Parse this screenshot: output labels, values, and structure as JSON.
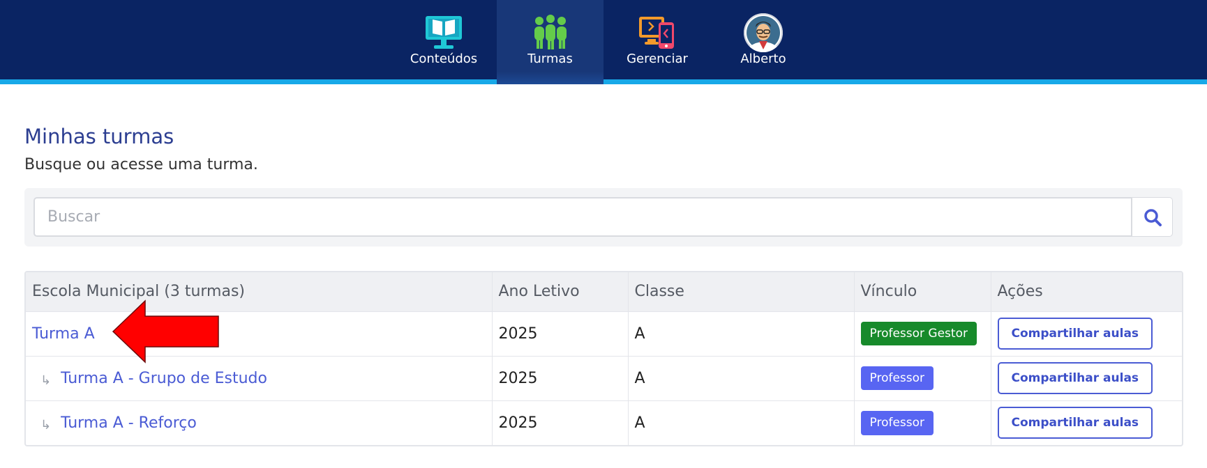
{
  "nav": {
    "items": [
      {
        "label": "Conteúdos",
        "icon": "monitor-book-icon"
      },
      {
        "label": "Turmas",
        "icon": "people-group-icon",
        "active": true
      },
      {
        "label": "Gerenciar",
        "icon": "devices-manage-icon"
      },
      {
        "label": "Alberto",
        "icon": "user-avatar"
      }
    ]
  },
  "page": {
    "title": "Minhas turmas",
    "subtitle": "Busque ou acesse uma turma."
  },
  "search": {
    "placeholder": "Buscar",
    "value": ""
  },
  "table": {
    "headers": [
      "Escola Municipal (3 turmas)",
      "Ano Letivo",
      "Classe",
      "Vínculo",
      "Ações"
    ],
    "rows": [
      {
        "name": "Turma A",
        "year": "2025",
        "classe": "A",
        "vinculo": "Professor Gestor",
        "action": "Compartilhar aulas",
        "sub": false
      },
      {
        "name": "Turma A - Grupo de Estudo",
        "year": "2025",
        "classe": "A",
        "vinculo": "Professor",
        "action": "Compartilhar aulas",
        "sub": true
      },
      {
        "name": "Turma A - Reforço",
        "year": "2025",
        "classe": "A",
        "vinculo": "Professor",
        "action": "Compartilhar aulas",
        "sub": true
      }
    ]
  },
  "colors": {
    "topbar": "#0a2463",
    "accent_line": "#18a9e8",
    "title": "#2c3e91",
    "link": "#4a5bd4",
    "badge_gestor": "#178a2b",
    "badge_professor": "#5865f2",
    "annotation_arrow": "#ff0000"
  }
}
